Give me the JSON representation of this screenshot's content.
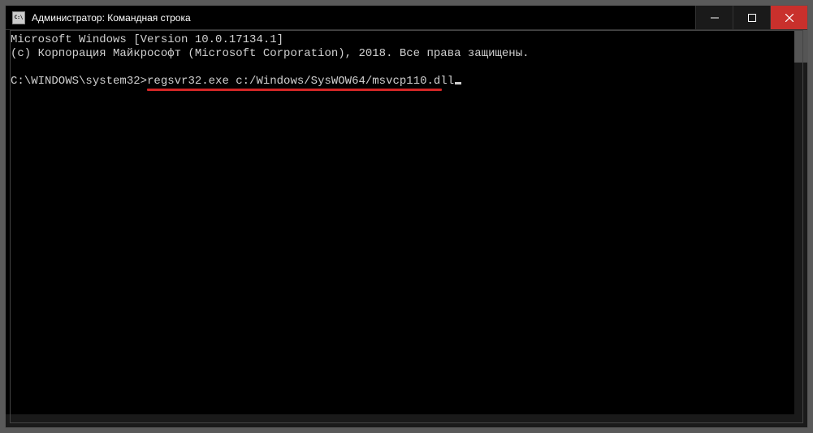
{
  "window": {
    "icon_label": "C:\\",
    "title": "Администратор: Командная строка"
  },
  "terminal": {
    "line1": "Microsoft Windows [Version 10.0.17134.1]",
    "line2": "(c) Корпорация Майкрософт (Microsoft Corporation), 2018. Все права защищены.",
    "prompt_prefix": "C:\\WINDOWS\\system32>",
    "command": "regsvr32.exe c:/Windows/SysWOW64/msvcp110.dll"
  }
}
